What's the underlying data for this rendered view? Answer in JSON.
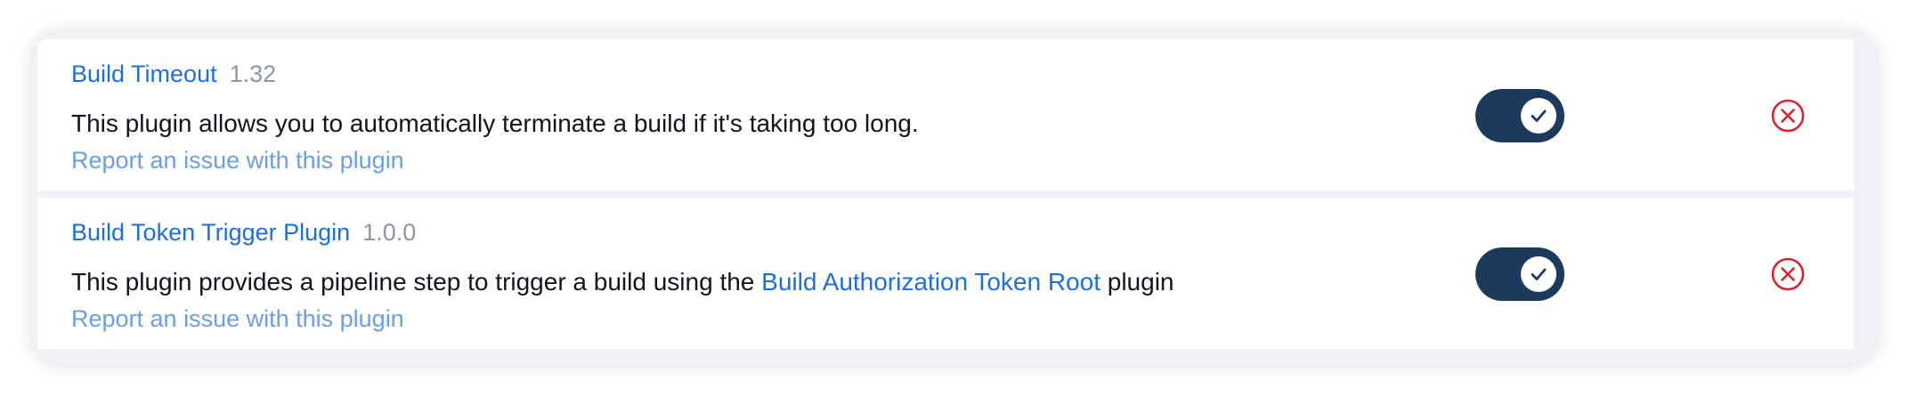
{
  "plugins": [
    {
      "name": "Build Timeout",
      "version": "1.32",
      "description_before": "This plugin allows you to automatically terminate a build if it's taking too long.",
      "description_link": "",
      "description_after": "",
      "report_link": "Report an issue with this plugin",
      "enabled": true
    },
    {
      "name": "Build Token Trigger Plugin",
      "version": "1.0.0",
      "description_before": "This plugin provides a pipeline step to trigger a build using the ",
      "description_link": "Build Authorization Token Root",
      "description_after": " plugin",
      "report_link": "Report an issue with this plugin",
      "enabled": true
    }
  ],
  "colors": {
    "link": "#1f6fdb",
    "report_link": "#6b9fe3",
    "version": "#8f96a3",
    "toggle_on": "#1b3a5c",
    "remove": "#d9232e"
  },
  "icons": {
    "toggle_check": "check-icon",
    "remove": "close-circle-icon"
  }
}
